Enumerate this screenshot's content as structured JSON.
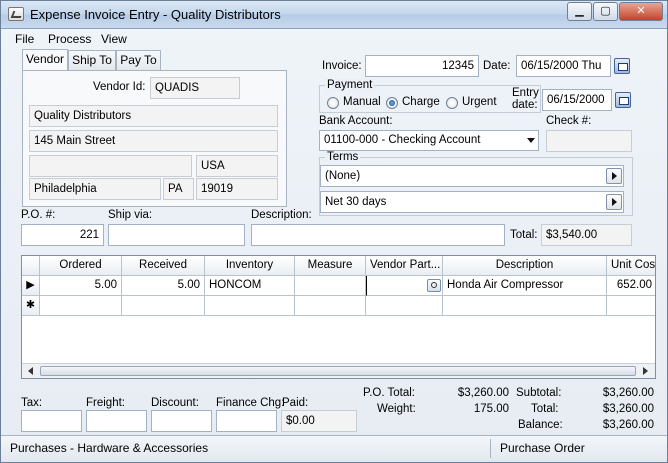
{
  "window": {
    "title": "Expense Invoice Entry - Quality Distributors",
    "min_glyph": "▁",
    "max_glyph": "▢",
    "close_glyph": "✕"
  },
  "menu": [
    {
      "label": "File"
    },
    {
      "label": "Process"
    },
    {
      "label": "View"
    }
  ],
  "tabs": [
    {
      "label": "Vendor"
    },
    {
      "label": "Ship To"
    },
    {
      "label": "Pay To"
    }
  ],
  "vendor": {
    "id_label": "Vendor Id:",
    "id": "QUADIS",
    "name": "Quality Distributors",
    "address1": "145 Main Street",
    "address2": "",
    "country": "USA",
    "city": "Philadelphia",
    "state": "PA",
    "zip": "19019"
  },
  "invoice": {
    "invoice_label": "Invoice:",
    "invoice_no": "12345",
    "date_label": "Date:",
    "date": "06/15/2000 Thu",
    "entry_date_label": "Entry date:",
    "entry_date": "06/15/2000",
    "payment_label": "Payment",
    "payment_options": [
      "Manual",
      "Charge",
      "Urgent"
    ],
    "payment_selected": "Charge",
    "bank_label": "Bank Account:",
    "bank_account": "01100-000 - Checking Account",
    "check_label": "Check #:",
    "check_no": "",
    "terms_label": "Terms",
    "terms1": "(None)",
    "terms2": "Net  30 days"
  },
  "order": {
    "po_label": "P.O. #:",
    "po": "221",
    "shipvia_label": "Ship via:",
    "shipvia": "",
    "description_label": "Description:",
    "description": "",
    "total_label": "Total:",
    "total": "$3,540.00"
  },
  "grid": {
    "columns": [
      "Ordered",
      "Received",
      "Inventory",
      "Measure",
      "Vendor Part...",
      "Description",
      "Unit Cost"
    ],
    "rows": [
      {
        "marker": "▶",
        "ordered": "5.00",
        "received": "5.00",
        "inventory": "HONCOM",
        "measure": "",
        "vendor_part": "",
        "description": "Honda Air Compressor",
        "unit_cost": "652.00"
      }
    ],
    "new_row_marker": "✱"
  },
  "footer": {
    "tax_label": "Tax:",
    "tax": "",
    "freight_label": "Freight:",
    "freight": "",
    "discount_label": "Discount:",
    "discount": "",
    "finance_label": "Finance Chg:",
    "finance": "",
    "paid_label": "Paid:",
    "paid": "$0.00",
    "po_total_label": "P.O. Total:",
    "po_total": "$3,260.00",
    "weight_label": "Weight:",
    "weight": "175.00",
    "subtotal_label": "Subtotal:",
    "subtotal": "$3,260.00",
    "total_label": "Total:",
    "total": "$3,260.00",
    "balance_label": "Balance:",
    "balance": "$3,260.00"
  },
  "status": {
    "left": "Purchases - Hardware & Accessories",
    "right": "Purchase Order"
  }
}
